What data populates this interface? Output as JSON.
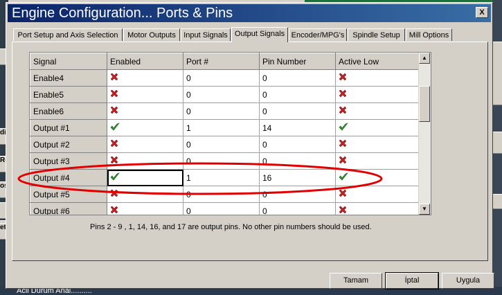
{
  "window": {
    "title": "Engine Configuration... Ports & Pins",
    "close_label": "X"
  },
  "tabs": [
    {
      "label": "Port Setup and Axis Selection",
      "active": false
    },
    {
      "label": "Motor Outputs",
      "active": false
    },
    {
      "label": "Input Signals",
      "active": false
    },
    {
      "label": "Output Signals",
      "active": true
    },
    {
      "label": "Encoder/MPG's",
      "active": false
    },
    {
      "label": "Spindle Setup",
      "active": false
    },
    {
      "label": "Mill Options",
      "active": false
    }
  ],
  "table": {
    "columns": [
      "Signal",
      "Enabled",
      "Port #",
      "Pin Number",
      "Active Low"
    ],
    "rows": [
      {
        "signal": "Enable4",
        "enabled": "x-icon",
        "port": "0",
        "pin": "0",
        "active_low": "x-icon"
      },
      {
        "signal": "Enable5",
        "enabled": "x-icon",
        "port": "0",
        "pin": "0",
        "active_low": "x-icon"
      },
      {
        "signal": "Enable6",
        "enabled": "x-icon",
        "port": "0",
        "pin": "0",
        "active_low": "x-icon"
      },
      {
        "signal": "Output #1",
        "enabled": "check-icon",
        "port": "1",
        "pin": "14",
        "active_low": "check-icon"
      },
      {
        "signal": "Output #2",
        "enabled": "x-icon",
        "port": "0",
        "pin": "0",
        "active_low": "x-icon"
      },
      {
        "signal": "Output #3",
        "enabled": "x-icon",
        "port": "0",
        "pin": "0",
        "active_low": "x-icon"
      },
      {
        "signal": "Output #4",
        "enabled": "check-icon",
        "port": "1",
        "pin": "16",
        "active_low": "check-icon",
        "selected": true
      },
      {
        "signal": "Output #5",
        "enabled": "x-icon",
        "port": "0",
        "pin": "0",
        "active_low": "x-icon"
      },
      {
        "signal": "Output #6",
        "enabled": "x-icon",
        "port": "0",
        "pin": "0",
        "active_low": "x-icon"
      }
    ]
  },
  "note": "Pins 2 - 9 , 1, 14, 16, and 17 are output pins.  No  other pin numbers should be used.",
  "buttons": {
    "ok": "Tamam",
    "cancel": "İptal",
    "apply": "Uygula"
  },
  "background": {
    "bottom_text": "Acil Durum Anal..........",
    "left_strips": [
      "",
      "di",
      "Re",
      "os",
      "",
      "",
      "et"
    ]
  },
  "colors": {
    "titlebar": "#0a246a",
    "x_icon": "#c02020",
    "check_icon": "#2e9a2e",
    "ellipse": "#e00000"
  }
}
